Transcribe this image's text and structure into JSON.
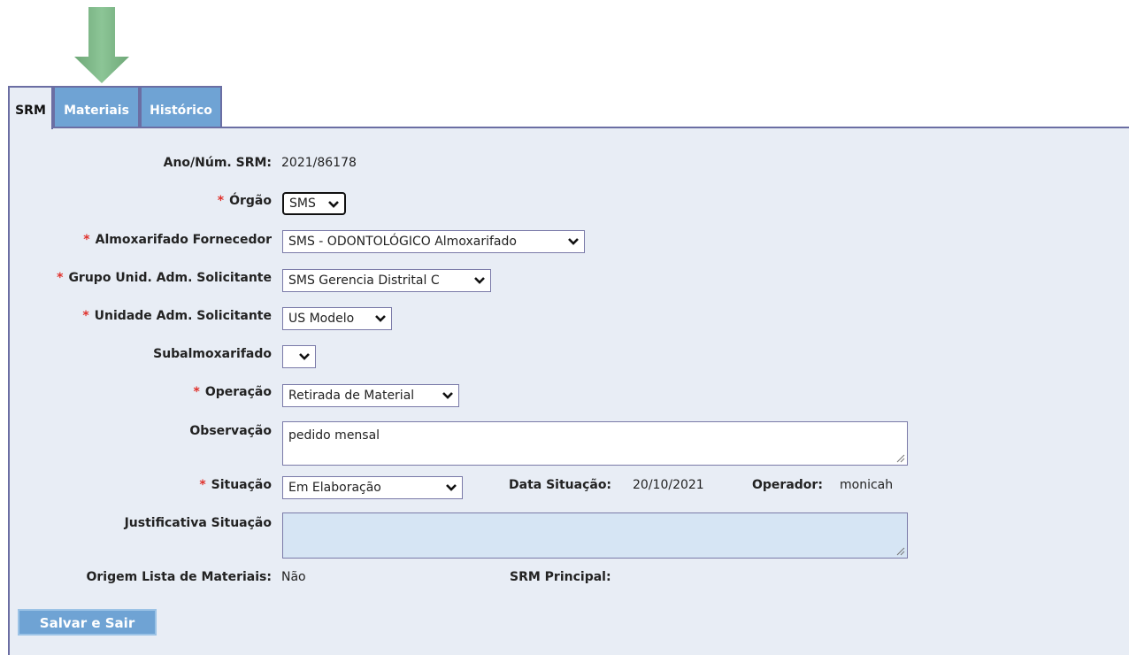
{
  "tabs": [
    {
      "label": "SRM"
    },
    {
      "label": "Materiais"
    },
    {
      "label": "Histórico"
    }
  ],
  "form": {
    "ano_num": {
      "label": "Ano/Núm. SRM:",
      "value": "2021/86178"
    },
    "orgao": {
      "label": "Órgão",
      "value": "SMS",
      "required": "*"
    },
    "almoxarifado": {
      "label": "Almoxarifado Fornecedor",
      "value": "SMS - ODONTOLÓGICO Almoxarifado",
      "required": "*"
    },
    "grupo": {
      "label": "Grupo Unid. Adm. Solicitante",
      "value": "SMS Gerencia Distrital C",
      "required": "*"
    },
    "unidade": {
      "label": "Unidade Adm. Solicitante",
      "value": "US Modelo",
      "required": "*"
    },
    "subalmoxarifado": {
      "label": "Subalmoxarifado",
      "value": ""
    },
    "operacao": {
      "label": "Operação",
      "value": "Retirada de Material",
      "required": "*"
    },
    "observacao": {
      "label": "Observação",
      "value": "pedido mensal"
    },
    "situacao": {
      "label": "Situação",
      "value": "Em Elaboração",
      "required": "*"
    },
    "data_situacao": {
      "label": "Data Situação:",
      "value": "20/10/2021"
    },
    "operador": {
      "label": "Operador:",
      "value": "monicah"
    },
    "justificativa": {
      "label": "Justificativa Situação",
      "value": ""
    },
    "origem": {
      "label": "Origem Lista de Materiais:",
      "value": "Não"
    },
    "srm_principal": {
      "label": "SRM Principal:",
      "value": ""
    }
  },
  "actions": {
    "save_label": "Salvar e Sair"
  },
  "colors": {
    "tab_blue": "#6fa3d4",
    "panel_bg": "#e8edf5",
    "border": "#6b6ea3",
    "required": "#e0302a",
    "arrow": "#7fb88a"
  },
  "icons": {
    "arrow": "down-arrow-icon",
    "dropdown": "chevron-down-icon",
    "resize": "resize-grip-icon"
  }
}
